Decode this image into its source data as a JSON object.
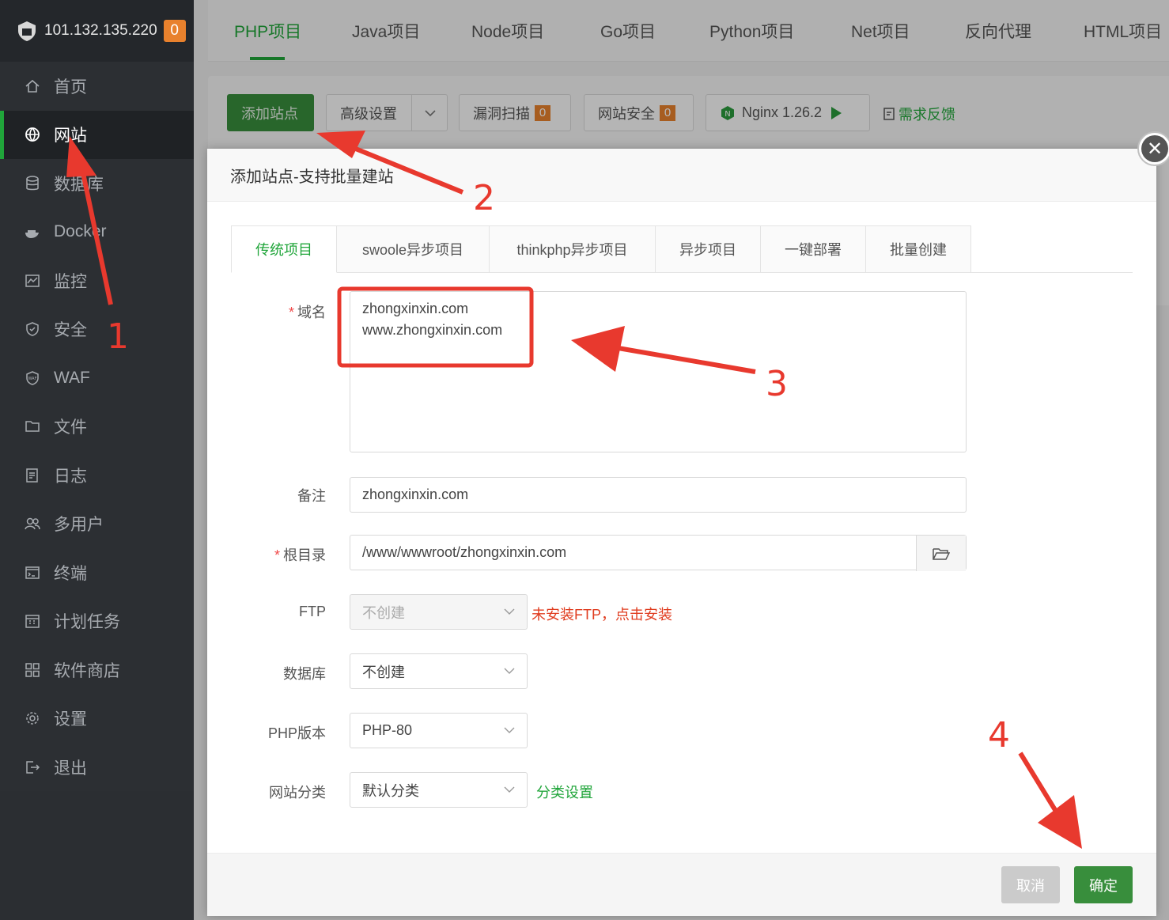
{
  "sidebar": {
    "server_ip": "101.132.135.220",
    "server_badge": "0",
    "items": [
      {
        "label": "首页",
        "icon": "home-icon"
      },
      {
        "label": "网站",
        "icon": "globe-icon"
      },
      {
        "label": "数据库",
        "icon": "database-icon"
      },
      {
        "label": "Docker",
        "icon": "docker-icon"
      },
      {
        "label": "监控",
        "icon": "monitor-icon"
      },
      {
        "label": "安全",
        "icon": "shield-icon"
      },
      {
        "label": "WAF",
        "icon": "waf-icon"
      },
      {
        "label": "文件",
        "icon": "folder-icon"
      },
      {
        "label": "日志",
        "icon": "log-icon"
      },
      {
        "label": "多用户",
        "icon": "users-icon"
      },
      {
        "label": "终端",
        "icon": "terminal-icon"
      },
      {
        "label": "计划任务",
        "icon": "calendar-icon"
      },
      {
        "label": "软件商店",
        "icon": "apps-icon"
      },
      {
        "label": "设置",
        "icon": "gear-icon"
      },
      {
        "label": "退出",
        "icon": "logout-icon"
      }
    ]
  },
  "top_tabs": [
    "PHP项目",
    "Java项目",
    "Node项目",
    "Go项目",
    "Python项目",
    "Net项目",
    "反向代理",
    "HTML项目"
  ],
  "toolbar": {
    "add_site": "添加站点",
    "advanced": "高级设置",
    "vuln_scan": "漏洞扫描",
    "vuln_count": "0",
    "site_security": "网站安全",
    "security_count": "0",
    "nginx": "Nginx 1.26.2",
    "feedback": "需求反馈"
  },
  "modal": {
    "title": "添加站点-支持批量建站",
    "tabs": [
      "传统项目",
      "swoole异步项目",
      "thinkphp异步项目",
      "异步项目",
      "一键部署",
      "批量创建"
    ],
    "fields": {
      "domain_label": "域名",
      "domain_lines": [
        "zhongxinxin.com",
        "www.zhongxinxin.com"
      ],
      "remark_label": "备注",
      "remark_value": "zhongxinxin.com",
      "root_label": "根目录",
      "root_value": "/www/wwwroot/zhongxinxin.com",
      "ftp_label": "FTP",
      "ftp_value": "不创建",
      "ftp_hint": "未安装FTP，点击安装",
      "db_label": "数据库",
      "db_value": "不创建",
      "php_label": "PHP版本",
      "php_value": "PHP-80",
      "category_label": "网站分类",
      "category_value": "默认分类",
      "category_link": "分类设置"
    },
    "cancel": "取消",
    "confirm": "确定"
  },
  "annotations": [
    "1",
    "2",
    "3",
    "4"
  ],
  "colors": {
    "accent": "#20a53a",
    "annotation": "#e8392e",
    "badge": "#e8812d"
  }
}
